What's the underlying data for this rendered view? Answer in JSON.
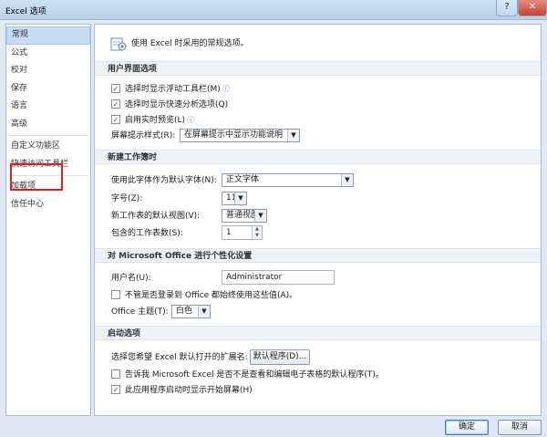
{
  "window": {
    "title": "Excel 选项",
    "help_label": "?",
    "close_label": "✕"
  },
  "sidebar": {
    "items": [
      {
        "label": "常规"
      },
      {
        "label": "公式"
      },
      {
        "label": "校对"
      },
      {
        "label": "保存"
      },
      {
        "label": "语言"
      },
      {
        "label": "高级"
      },
      {
        "label": "自定义功能区"
      },
      {
        "label": "快速访问工具栏"
      },
      {
        "label": "加载项"
      },
      {
        "label": "信任中心"
      }
    ]
  },
  "main": {
    "intro": "使用 Excel 时采用的常规选项。",
    "ui_section": {
      "title": "用户界面选项",
      "mini_toolbar": "选择时显示浮动工具栏(M)",
      "quick_analysis": "选择时显示快速分析选项(Q)",
      "live_preview": "启用实时预览(L)",
      "tooltip_style_label": "屏幕提示样式(R):",
      "tooltip_style_value": "在屏幕提示中显示功能说明"
    },
    "new_wb_section": {
      "title": "新建工作簿时",
      "font_label": "使用此字体作为默认字体(N):",
      "font_value": "正文字体",
      "size_label": "字号(Z):",
      "size_value": "11",
      "view_label": "新工作表的默认视图(V):",
      "view_value": "普通视图",
      "sheets_label": "包含的工作表数(S):",
      "sheets_value": "1"
    },
    "personalize_section": {
      "title": "对 Microsoft Office 进行个性化设置",
      "username_label": "用户名(U):",
      "username_value": "Administrator",
      "always_use": "不管是否登录到 Office 都始终使用这些值(A)。",
      "theme_label": "Office 主题(T):",
      "theme_value": "白色"
    },
    "startup_section": {
      "title": "启动选项",
      "ext_label": "选择您希望 Excel 默认打开的扩展名:",
      "default_programs_button": "默认程序(D)...",
      "tell_me": "告诉我 Microsoft Excel 是否不是查看和编辑电子表格的默认程序(T)。",
      "show_start": "此应用程序启动时显示开始屏幕(H)"
    }
  },
  "footer": {
    "ok": "确定",
    "cancel": "取消"
  },
  "colors": {
    "highlight_box": "#e02020",
    "active_item": "#c6dcf5"
  },
  "checkbox_states": {
    "mini_toolbar": true,
    "quick_analysis": true,
    "live_preview": true,
    "always_use": false,
    "tell_me": false,
    "show_start": true
  }
}
